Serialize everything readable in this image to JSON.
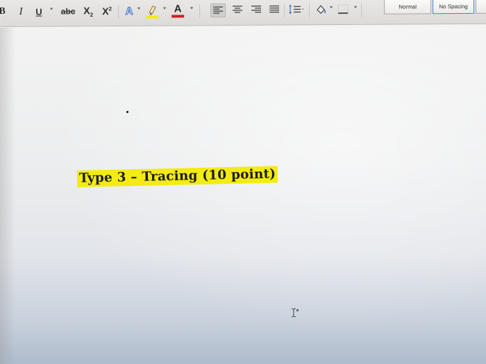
{
  "toolbar": {
    "bold_label": "B",
    "italic_label": "I",
    "underline_label": "U",
    "strikethrough_label": "abc",
    "subscript_base": "X",
    "subscript_mark": "2",
    "superscript_base": "X",
    "superscript_mark": "2",
    "text_effects_label": "A",
    "font_color_label": "A",
    "highlight_color": "#f3eb12",
    "font_color": "#d11f1f",
    "alignment_selected": "left"
  },
  "styles": {
    "normal_label": "Normal",
    "no_spacing_label": "No Spacing",
    "active_style": "No Spacing"
  },
  "document": {
    "heading_text": "Type 3 – Tracing (10 point)",
    "heading_highlight": "#f3eb12"
  },
  "icons": [
    "bold-icon",
    "italic-icon",
    "underline-icon",
    "strikethrough-icon",
    "subscript-icon",
    "superscript-icon",
    "text-effects-icon",
    "highlight-icon",
    "font-color-icon",
    "align-left-icon",
    "align-center-icon",
    "align-right-icon",
    "justify-icon",
    "line-spacing-icon",
    "shading-icon",
    "borders-icon",
    "text-cursor-icon"
  ]
}
